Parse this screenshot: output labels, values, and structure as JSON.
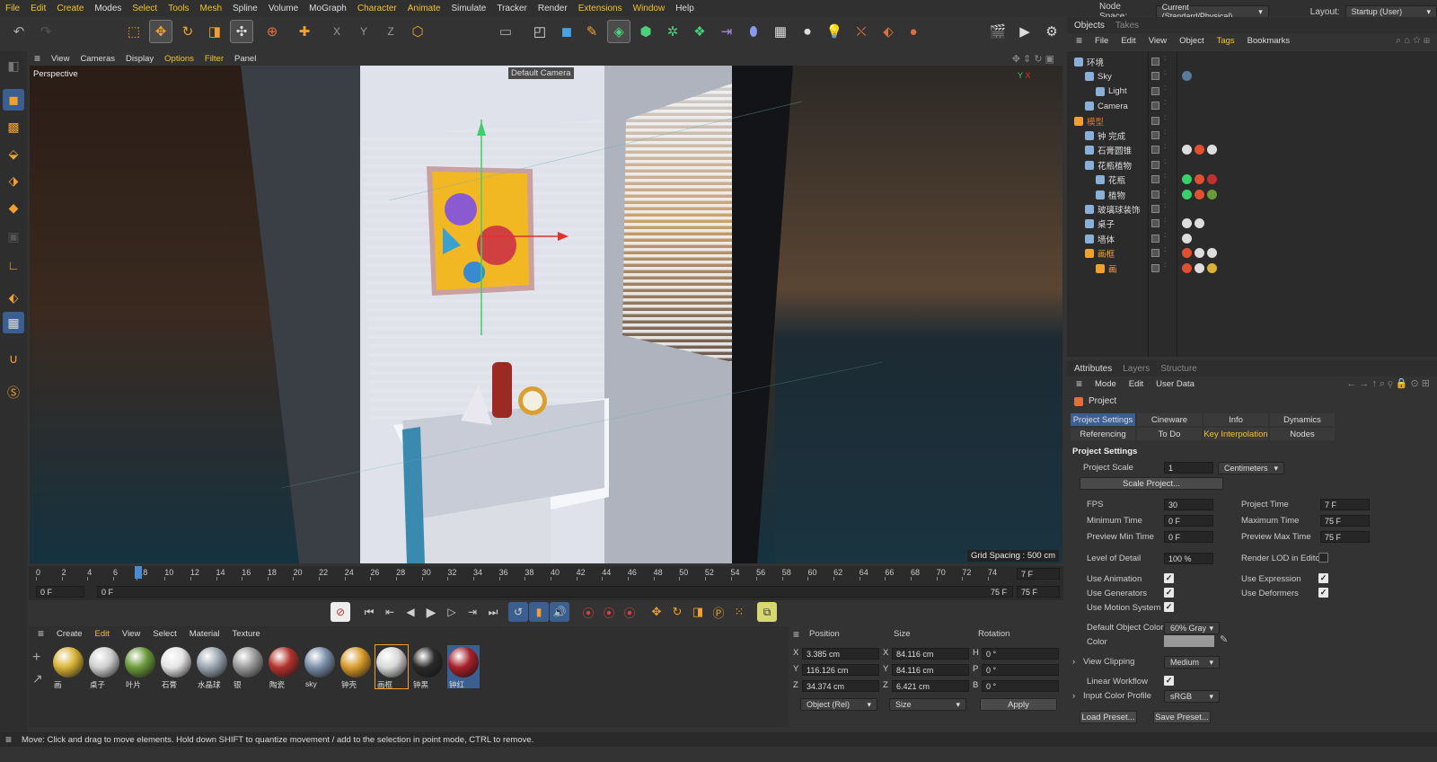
{
  "menu": [
    "File",
    "Edit",
    "Create",
    "Modes",
    "Select",
    "Tools",
    "Mesh",
    "Spline",
    "Volume",
    "MoGraph",
    "Character",
    "Animate",
    "Simulate",
    "Tracker",
    "Render",
    "Extensions",
    "Window",
    "Help"
  ],
  "node_space": {
    "label": "Node Space:",
    "value": "Current (Standard/Physical)",
    "layout_label": "Layout:",
    "layout_value": "Startup (User)"
  },
  "viewport": {
    "menu": [
      "View",
      "Cameras",
      "Display",
      "Options",
      "Filter",
      "Panel"
    ],
    "name": "Perspective",
    "camera": "Default Camera",
    "grid_spacing": "Grid Spacing : 500 cm"
  },
  "timeline": {
    "ticks": [
      "0",
      "2",
      "4",
      "6",
      "7.8",
      "10",
      "12",
      "14",
      "16",
      "18",
      "20",
      "22",
      "24",
      "26",
      "28",
      "30",
      "32",
      "34",
      "36",
      "38",
      "40",
      "42",
      "44",
      "46",
      "48",
      "50",
      "52",
      "54",
      "56",
      "58",
      "60",
      "62",
      "64",
      "66",
      "68",
      "70",
      "72",
      "74"
    ],
    "current_frame": "7 F",
    "start": "0 F",
    "range_start": "0 F",
    "range_end": "75 F",
    "end": "75 F",
    "current_position": 7.8,
    "max": 75
  },
  "materials": {
    "menu": [
      "Create",
      "Edit",
      "View",
      "Select",
      "Material",
      "Texture"
    ],
    "items": [
      {
        "name": "画",
        "color": "#d9b335"
      },
      {
        "name": "桌子",
        "color": "#cfcfcf"
      },
      {
        "name": "叶片",
        "color": "#6a9a3a"
      },
      {
        "name": "石膏",
        "color": "#e4e4e4"
      },
      {
        "name": "水晶球",
        "color": "#9aa6b0"
      },
      {
        "name": "银",
        "color": "#9a9a9a"
      },
      {
        "name": "陶瓷",
        "color": "#b3322c"
      },
      {
        "name": "sky",
        "color": "#7a8ea8"
      },
      {
        "name": "钟壳",
        "color": "#d89a2a"
      },
      {
        "name": "画框",
        "color": "#d8d8d8"
      },
      {
        "name": "钟黑",
        "color": "#2a2a2a"
      },
      {
        "name": "钟红",
        "color": "#a8202a"
      }
    ]
  },
  "coordinates": {
    "headers": [
      "Position",
      "Size",
      "Rotation"
    ],
    "rows": [
      {
        "axis": "X",
        "pos": "3.385 cm",
        "size_axis": "X",
        "size": "84.116 cm",
        "rot_axis": "H",
        "rot": "0 °"
      },
      {
        "axis": "Y",
        "pos": "116.126 cm",
        "size_axis": "Y",
        "size": "84.116 cm",
        "rot_axis": "P",
        "rot": "0 °"
      },
      {
        "axis": "Z",
        "pos": "34.374 cm",
        "size_axis": "Z",
        "size": "6.421 cm",
        "rot_axis": "B",
        "rot": "0 °"
      }
    ],
    "mode": "Object (Rel)",
    "size_mode": "Size",
    "apply": "Apply"
  },
  "status": "Move: Click and drag to move elements. Hold down SHIFT to quantize movement / add to the selection in point mode, CTRL to remove.",
  "objects": {
    "tabs": [
      "Objects",
      "Takes"
    ],
    "menu": [
      "File",
      "Edit",
      "View",
      "Object",
      "Tags",
      "Bookmarks"
    ],
    "tree": [
      {
        "name": "环境",
        "indent": 0,
        "color": "#ddd"
      },
      {
        "name": "Sky",
        "indent": 1,
        "color": "#ddd"
      },
      {
        "name": "Light",
        "indent": 2,
        "color": "#ddd"
      },
      {
        "name": "Camera",
        "indent": 1,
        "color": "#ddd"
      },
      {
        "name": "模型",
        "indent": 0,
        "color": "#e07a30"
      },
      {
        "name": "钟 完成",
        "indent": 1,
        "color": "#ddd"
      },
      {
        "name": "石膏圆锥",
        "indent": 1,
        "color": "#ddd"
      },
      {
        "name": "花瓶植物",
        "indent": 1,
        "color": "#ddd"
      },
      {
        "name": "花瓶",
        "indent": 2,
        "color": "#ddd"
      },
      {
        "name": "植物",
        "indent": 2,
        "color": "#ddd"
      },
      {
        "name": "玻璃球装饰",
        "indent": 1,
        "color": "#ddd"
      },
      {
        "name": "桌子",
        "indent": 1,
        "color": "#ddd"
      },
      {
        "name": "墙体",
        "indent": 1,
        "color": "#ddd"
      },
      {
        "name": "画框",
        "indent": 1,
        "color": "#f1a232"
      },
      {
        "name": "画",
        "indent": 2,
        "color": "#f1a232"
      }
    ]
  },
  "attributes": {
    "tabs": [
      "Attributes",
      "Layers",
      "Structure"
    ],
    "menu": [
      "Mode",
      "Edit",
      "User Data"
    ],
    "title": "Project",
    "ptabs": [
      "Project Settings",
      "Cineware",
      "Info",
      "Dynamics",
      "Referencing",
      "To Do",
      "Key Interpolation",
      "Nodes"
    ],
    "section": "Project Settings",
    "project_scale_label": "Project Scale",
    "project_scale": "1",
    "units": "Centimeters",
    "scale_project": "Scale Project...",
    "fps_label": "FPS",
    "fps": "30",
    "project_time_label": "Project Time",
    "project_time": "7 F",
    "min_time_label": "Minimum Time",
    "min_time": "0 F",
    "max_time_label": "Maximum Time",
    "max_time": "75 F",
    "pmin_label": "Preview Min Time",
    "pmin": "0 F",
    "pmax_label": "Preview Max Time",
    "pmax": "75 F",
    "lod_label": "Level of Detail",
    "lod": "100 %",
    "render_lod_label": "Render LOD in Editor",
    "use_animation": "Use Animation",
    "use_expression": "Use Expression",
    "use_generators": "Use Generators",
    "use_deformers": "Use Deformers",
    "use_motion": "Use Motion System",
    "default_color_label": "Default Object Color",
    "default_color": "60% Gray",
    "color_label": "Color",
    "view_clipping_label": "View Clipping",
    "view_clipping": "Medium",
    "linear_workflow_label": "Linear Workflow",
    "input_profile_label": "Input Color Profile",
    "input_profile": "sRGB",
    "load_preset": "Load Preset...",
    "save_preset": "Save Preset..."
  }
}
